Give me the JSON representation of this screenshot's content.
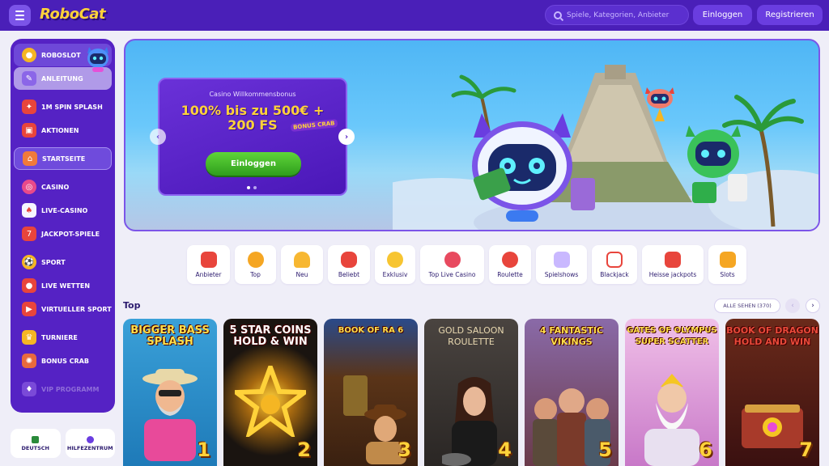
{
  "header": {
    "logo_text": "RoboCat",
    "search_placeholder": "Spiele, Kategorien, Anbieter",
    "login_label": "Einloggen",
    "register_label": "Registrieren"
  },
  "sidebar": {
    "items": [
      {
        "label": "ROBOSLOT",
        "icon": "coin-icon"
      },
      {
        "label": "ANLEITUNG",
        "icon": "guide-icon"
      },
      {
        "label": "1M SPIN SPLASH",
        "icon": "splash-icon"
      },
      {
        "label": "AKTIONEN",
        "icon": "gift-icon"
      },
      {
        "label": "STARTSEITE",
        "icon": "home-icon"
      },
      {
        "label": "CASINO",
        "icon": "casino-chip-icon"
      },
      {
        "label": "LIVE-CASINO",
        "icon": "live-cards-icon"
      },
      {
        "label": "JACKPOT-SPIELE",
        "icon": "jackpot-icon"
      },
      {
        "label": "SPORT",
        "icon": "ball-icon"
      },
      {
        "label": "LIVE WETTEN",
        "icon": "live-bet-icon"
      },
      {
        "label": "VIRTUELLER SPORT",
        "icon": "virtual-sport-icon"
      },
      {
        "label": "TURNIERE",
        "icon": "trophy-icon"
      },
      {
        "label": "BONUS CRAB",
        "icon": "crab-icon"
      },
      {
        "label": "VIP PROGRAMM",
        "icon": "vip-icon"
      }
    ],
    "language_label": "DEUTSCH",
    "help_label": "HILFEZENTRUM"
  },
  "banner": {
    "subtitle": "Casino Willkommensbonus",
    "headline_line1": "100% bis zu 500€ +",
    "headline_line2": "200 FS",
    "badge": "BONUS CRAB",
    "cta_label": "Einloggen"
  },
  "categories": [
    {
      "label": "Anbieter",
      "color": "#e8453c"
    },
    {
      "label": "Top",
      "color": "#f5a623"
    },
    {
      "label": "Neu",
      "color": "#f7b731"
    },
    {
      "label": "Beliebt",
      "color": "#e8453c"
    },
    {
      "label": "Exklusiv",
      "color": "#f7c531"
    },
    {
      "label": "Top Live Casino",
      "color": "#e84a5f"
    },
    {
      "label": "Roulette",
      "color": "#e8453c"
    },
    {
      "label": "Spielshows",
      "color": "#c9b8ff"
    },
    {
      "label": "Blackjack",
      "color": "#e8453c"
    },
    {
      "label": "Heisse jackpots",
      "color": "#e8453c"
    },
    {
      "label": "Slots",
      "color": "#f5a623"
    }
  ],
  "top_section": {
    "title": "Top",
    "see_all_label": "ALLE SEHEN (370)",
    "games": [
      {
        "title": "BIGGER BASS SPLASH",
        "rank": "1",
        "bg": "#3aa0d8"
      },
      {
        "title": "5 STAR COINS HOLD & WIN",
        "rank": "2",
        "bg": "#1a1410"
      },
      {
        "title": "BOOK OF RA 6",
        "rank": "3",
        "bg": "#4a2a14"
      },
      {
        "title": "GOLD SALOON ROULETTE",
        "rank": "4",
        "bg": "#3a3634"
      },
      {
        "title": "4 FANTASTIC VIKINGS",
        "rank": "5",
        "bg": "#7a4a6a"
      },
      {
        "title": "GATES OF OLYMPUS SUPER SCATTER",
        "rank": "6",
        "bg": "#e8a6d8"
      },
      {
        "title": "BOOK OF DRAGON HOLD AND WIN",
        "rank": "7",
        "bg": "#5a1e1a"
      }
    ]
  }
}
